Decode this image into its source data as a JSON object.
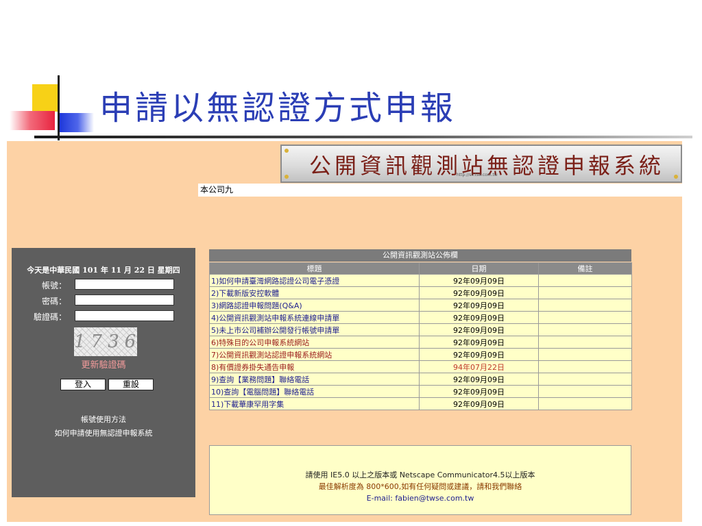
{
  "slide": {
    "title": "申請以無認證方式申報"
  },
  "banner": {
    "text": "公開資訊觀測站無認證申報系統",
    "url": "http://sii.tse.com.tw"
  },
  "company": {
    "name": "本公司九"
  },
  "login": {
    "date_text": "今天是中華民國 101 年 11 月 22 日 星期四",
    "account_label": "帳號：",
    "password_label": "密碼：",
    "captcha_label": "驗證碼：",
    "captcha_value": "1736",
    "refresh_label": "更新驗證碼",
    "login_button": "登入",
    "reset_button": "重設",
    "help_usage": "帳號使用方法",
    "help_apply": "如何申請使用無認證申報系統"
  },
  "bulletin": {
    "header": "公開資訊觀測站公佈欄",
    "columns": [
      "標題",
      "日期",
      "備註"
    ],
    "rows": [
      {
        "title": "1)如何申請臺灣網路認證公司電子憑證",
        "date": "92年09月09日",
        "note": ""
      },
      {
        "title": "2)下載新版安控軟體",
        "date": "92年09月09日",
        "note": ""
      },
      {
        "title": "3)網路認證申報問題(Q&A)",
        "date": "92年09月09日",
        "note": ""
      },
      {
        "title": "4)公開資訊觀測站申報系統連線申請單",
        "date": "92年09月09日",
        "note": ""
      },
      {
        "title": "5)未上市公司補辦公開發行帳號申請單",
        "date": "92年09月09日",
        "note": ""
      },
      {
        "title": "6)特殊目的公司申報系統網站",
        "date": "92年09月09日",
        "note": ""
      },
      {
        "title": "7)公開資訊觀測站認證申報系統網站",
        "date": "92年09月09日",
        "note": ""
      },
      {
        "title": "8)有價證券掛失通告申報",
        "date": "94年07月22日",
        "note": ""
      },
      {
        "title": "9)查詢【業務問題】聯絡電話",
        "date": "92年09月09日",
        "note": ""
      },
      {
        "title": "10)查詢【電腦問題】聯絡電話",
        "date": "92年09月09日",
        "note": ""
      },
      {
        "title": "11)下載華康罕用字集",
        "date": "92年09月09日",
        "note": ""
      }
    ],
    "footer_line1": "請使用 IE5.0 以上之版本或 Netscape Communicator4.5以上版本",
    "footer_line2": "最佳解析度為 800*600,如有任何疑問或建議，請和我們聯絡",
    "footer_line3": "E-mail: fabien@twse.com.tw"
  },
  "colors": {
    "title_blue": "#2b3eb5",
    "panel_bg": "#fdd2a5",
    "login_bg": "#5e5e5e",
    "row_bg": "#ffffc8",
    "link_red": "#9b1c1c",
    "link_blue": "#1f1f8f"
  }
}
